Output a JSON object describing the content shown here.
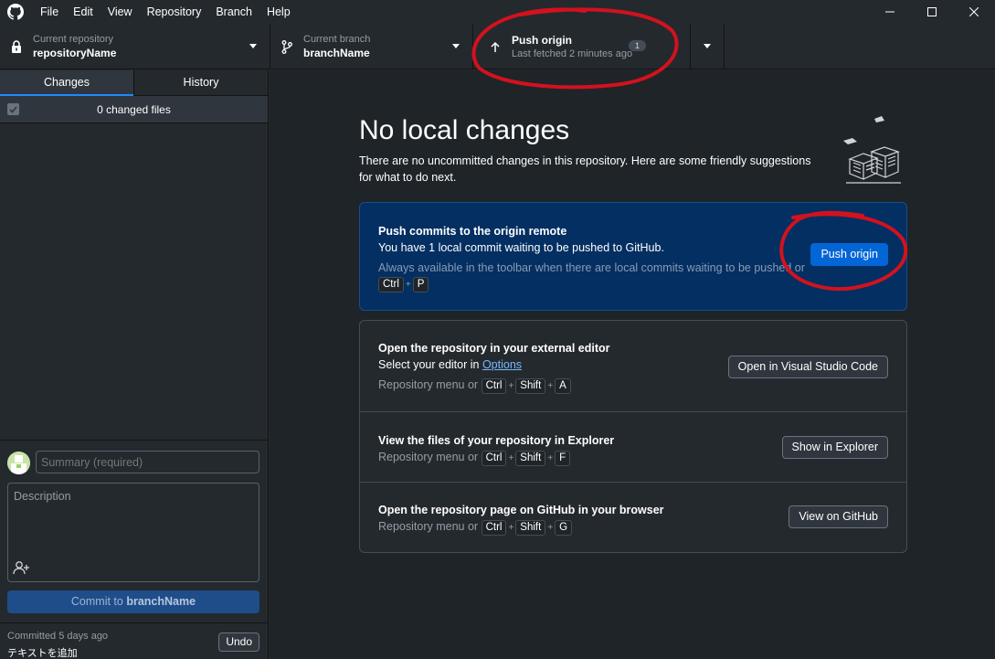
{
  "menu": [
    "File",
    "Edit",
    "View",
    "Repository",
    "Branch",
    "Help"
  ],
  "toolbar": {
    "repo_label": "Current repository",
    "repo_value": "repositoryName",
    "branch_label": "Current branch",
    "branch_value": "branchName",
    "push_title": "Push origin",
    "push_sub": "Last fetched 2 minutes ago",
    "push_badge": "1"
  },
  "tabs": {
    "changes": "Changes",
    "history": "History"
  },
  "files_header": "0 changed files",
  "commit": {
    "summary_placeholder": "Summary (required)",
    "description_placeholder": "Description",
    "button_prefix": "Commit to ",
    "button_branch": "branchName",
    "last_time": "Committed 5 days ago",
    "last_message": "テキストを追加",
    "undo": "Undo"
  },
  "main": {
    "title": "No local changes",
    "description": "There are no uncommitted changes in this repository. Here are some friendly suggestions for what to do next.",
    "push": {
      "title": "Push commits to the origin remote",
      "sub": "You have 1 local commit waiting to be pushed to GitHub.",
      "hint": "Always available in the toolbar when there are local commits waiting to be pushed or",
      "keys": [
        "Ctrl",
        "P"
      ],
      "button": "Push origin"
    },
    "editor": {
      "title": "Open the repository in your external editor",
      "sub_prefix": "Select your editor in ",
      "sub_link": "Options",
      "hint": "Repository menu or",
      "keys": [
        "Ctrl",
        "Shift",
        "A"
      ],
      "button": "Open in Visual Studio Code"
    },
    "explorer": {
      "title": "View the files of your repository in Explorer",
      "hint": "Repository menu or",
      "keys": [
        "Ctrl",
        "Shift",
        "F"
      ],
      "button": "Show in Explorer"
    },
    "github": {
      "title": "Open the repository page on GitHub in your browser",
      "hint": "Repository menu or",
      "keys": [
        "Ctrl",
        "Shift",
        "G"
      ],
      "button": "View on GitHub"
    }
  },
  "colors": {
    "annotation": "#d2121e",
    "accent": "#0366d6"
  }
}
